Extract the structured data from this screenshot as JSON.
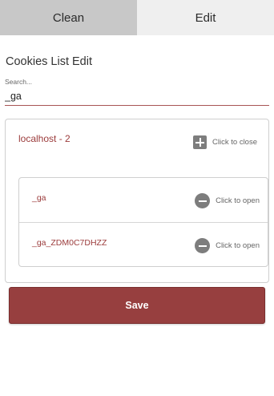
{
  "tabs": [
    {
      "label": "Clean"
    },
    {
      "label": "Edit"
    }
  ],
  "heading": "Cookies List Edit",
  "search": {
    "label": "Search...",
    "value": "_ga"
  },
  "domain_card": {
    "title": "localhost - 2",
    "action_label": "Click to close",
    "action_icon": "plus-square-icon",
    "cookies": [
      {
        "name": "_ga",
        "action_label": "Click to open",
        "action_icon": "minus-circle-icon"
      },
      {
        "name": "_ga_ZDM0C7DHZZ",
        "action_label": "Click to open",
        "action_icon": "minus-circle-icon"
      }
    ]
  },
  "save_button": {
    "label": "Save"
  },
  "colors": {
    "accent": "#973f3f",
    "link_text": "#9b3b3b",
    "tab_clean_bg": "#c8c8c8",
    "tab_edit_bg": "#efefef"
  }
}
